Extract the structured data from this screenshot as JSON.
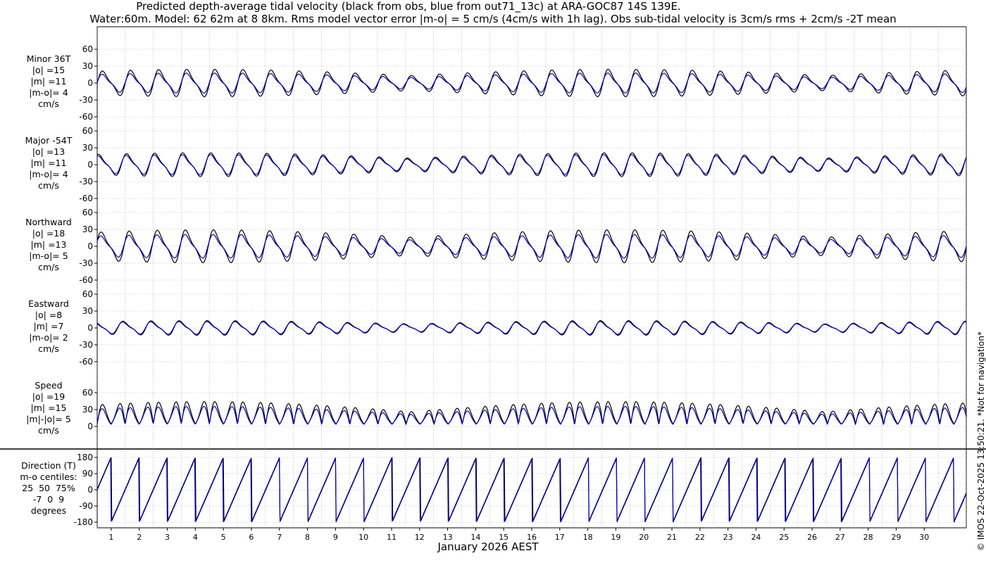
{
  "title": {
    "line1": "Predicted depth-average tidal velocity (black from obs, blue from out71_13c) at ARA-GOC87 14S 139E.",
    "line2": "Water:60m. Model: 62 62m at 8 8km. Rms model vector error |m-o| = 5 cm/s (4cm/s with 1h lag). Obs sub-tidal velocity is 3cm/s rms + 2cm/s -2T mean"
  },
  "credit": "© IMOS 22-Oct-2025 13:50:21. *Not for navigation*",
  "colors": {
    "obs": "#000000",
    "model": "#0000cc",
    "grid": "#9a9a9a"
  },
  "chart_data": {
    "type": "line",
    "xlabel": "January 2026 AEST",
    "x_ticks": [
      "1",
      "2",
      "3",
      "4",
      "5",
      "6",
      "7",
      "8",
      "9",
      "10",
      "11",
      "12",
      "13",
      "14",
      "15",
      "16",
      "17",
      "18",
      "19",
      "20",
      "21",
      "22",
      "23",
      "24",
      "25",
      "26",
      "27",
      "28",
      "29",
      "30"
    ],
    "series_names": [
      "obs",
      "model"
    ],
    "panels": [
      {
        "key": "minor",
        "label_lines": [
          "Minor 36T",
          "|o| =15",
          "|m| =11",
          "|m-o|= 4",
          "cm/s"
        ],
        "yticks": [
          "60",
          "30",
          "0",
          "-30",
          "-60"
        ],
        "ylim": [
          -60,
          60
        ],
        "amp_obs": 15,
        "amp_model": 11
      },
      {
        "key": "major",
        "label_lines": [
          "Major -54T",
          "|o| =13",
          "|m| =11",
          "|m-o|= 4",
          "cm/s"
        ],
        "yticks": [
          "60",
          "30",
          "0",
          "-30",
          "-60"
        ],
        "ylim": [
          -60,
          60
        ],
        "amp_obs": 13,
        "amp_model": 11
      },
      {
        "key": "north",
        "label_lines": [
          "Northward",
          "|o| =18",
          "|m| =13",
          "|m-o|= 5",
          "cm/s"
        ],
        "yticks": [
          "60",
          "30",
          "0",
          "-30",
          "-60"
        ],
        "ylim": [
          -60,
          60
        ],
        "amp_obs": 18,
        "amp_model": 13
      },
      {
        "key": "east",
        "label_lines": [
          "Eastward",
          "|o| =8",
          "|m| =7",
          "|m-o|= 2",
          "cm/s"
        ],
        "yticks": [
          "60",
          "30",
          "0",
          "-30",
          "-60"
        ],
        "ylim": [
          -60,
          60
        ],
        "amp_obs": 8,
        "amp_model": 7
      },
      {
        "key": "speed",
        "label_lines": [
          "Speed",
          "|o| =19",
          "|m| =15",
          "|m|-|o|= 5",
          "cm/s"
        ],
        "yticks": [
          "60",
          "30",
          "0"
        ],
        "ylim": [
          0,
          60
        ],
        "amp_obs": 19,
        "amp_model": 15
      },
      {
        "key": "direction",
        "label_lines": [
          "Direction (T)",
          "m-o centiles:",
          "25  50  75%",
          "-7  0  9",
          "degrees"
        ],
        "yticks": [
          "180",
          "90",
          "0",
          "-90",
          "-180"
        ],
        "ylim": [
          -180,
          180
        ]
      }
    ]
  }
}
